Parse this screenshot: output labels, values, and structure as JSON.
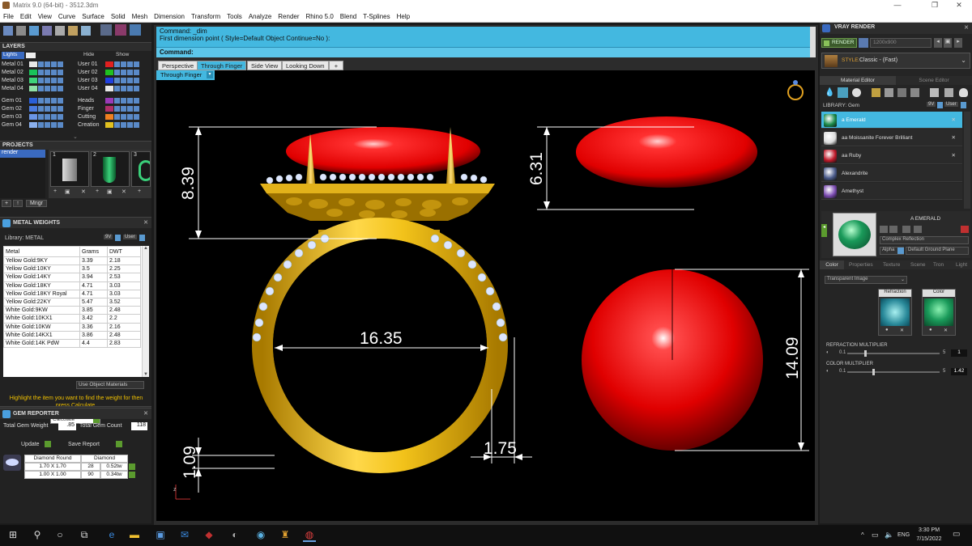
{
  "window": {
    "title": "Matrix 9.0 (64-bit) - 3512.3dm"
  },
  "menu": [
    "File",
    "Edit",
    "View",
    "Curve",
    "Surface",
    "Solid",
    "Mesh",
    "Dimension",
    "Transform",
    "Tools",
    "Analyze",
    "Render",
    "Rhino 5.0",
    "Blend",
    "T-Splines",
    "Help"
  ],
  "layers": {
    "title": "LAYERS",
    "toolbar": {
      "lights": "Lights",
      "hide": "Hide",
      "show": "Show"
    },
    "left": [
      {
        "name": "Metal 01",
        "color": "#e8e8e8"
      },
      {
        "name": "Metal 02",
        "color": "#19c35a"
      },
      {
        "name": "Metal 03",
        "color": "#3ed37a"
      },
      {
        "name": "Metal 04",
        "color": "#8fe0a6"
      },
      {
        "name": "Gem 01",
        "color": "#2a5fd8"
      },
      {
        "name": "Gem 02",
        "color": "#4a7be0"
      },
      {
        "name": "Gem 03",
        "color": "#6a95e6"
      },
      {
        "name": "Gem 04",
        "color": "#8ab0ee"
      }
    ],
    "right": [
      {
        "name": "User 01",
        "color": "#e02020"
      },
      {
        "name": "User 02",
        "color": "#20c020"
      },
      {
        "name": "User 03",
        "color": "#2040e0"
      },
      {
        "name": "User 04",
        "color": "#e8e8e8"
      },
      {
        "name": "Heads",
        "color": "#9b3ab8"
      },
      {
        "name": "Finger",
        "color": "#b0306a"
      },
      {
        "name": "Cutting",
        "color": "#f08020"
      },
      {
        "name": "Creation",
        "color": "#e0c020"
      }
    ]
  },
  "projects": {
    "title": "PROJECTS",
    "item": "render",
    "thumbs": [
      "1",
      "2",
      "3"
    ],
    "buttons": {
      "add": "+",
      "up": "↑",
      "manager": "Mngr"
    }
  },
  "metal_weights": {
    "title": "METAL WEIGHTS",
    "library_label": "Library: METAL",
    "columns": [
      "Metal",
      "Grams",
      "DWT"
    ],
    "rows": [
      [
        "Yellow Gold:9KY",
        "3.39",
        "2.18"
      ],
      [
        "Yellow Gold:10KY",
        "3.5",
        "2.25"
      ],
      [
        "Yellow Gold:14KY",
        "3.94",
        "2.53"
      ],
      [
        "Yellow Gold:18KY",
        "4.71",
        "3.03"
      ],
      [
        "Yellow Gold:18KY Royal",
        "4.71",
        "3.03"
      ],
      [
        "Yellow Gold:22KY",
        "5.47",
        "3.52"
      ],
      [
        "White Gold:9KW",
        "3.85",
        "2.48"
      ],
      [
        "White Gold:10KX1",
        "3.42",
        "2.2"
      ],
      [
        "White Gold:10KW",
        "3.36",
        "2.16"
      ],
      [
        "White Gold:14KX1",
        "3.86",
        "2.48"
      ],
      [
        "White Gold:14K PdW",
        "4.4",
        "2.83"
      ]
    ],
    "use_object_materials": "Use Object Materials",
    "hint": "Highlight the item you want to find the weight for then press Calculate.",
    "calculate": "Calculate"
  },
  "gem_reporter": {
    "title": "GEM REPORTER",
    "total_weight_label": "Total Gem Weight",
    "total_weight": ".85",
    "total_count_label": "Total Gem Count",
    "total_count": "118",
    "update": "Update",
    "save_report": "Save Report",
    "columns": [
      "Diamond Round",
      "Diamond"
    ],
    "rows": [
      [
        "1.70 X 1.70",
        "28",
        "0.52tw"
      ],
      [
        "1.00 X 1.00",
        "90",
        "0.34tw"
      ]
    ]
  },
  "command": {
    "line1": "Command: _dim",
    "line2": "First dimension point ( Style=Default  Object  Continue=No ):",
    "label": "Command:"
  },
  "view_tabs": [
    "Perspective",
    "Through Finger",
    "Side View",
    "Looking Down",
    "+"
  ],
  "viewport_label": "Through Finger",
  "dimensions": {
    "height": "8.39",
    "top_height": "6.31",
    "inner_diameter": "16.35",
    "sphere_height": "14.09",
    "band_width": "1.75",
    "band_thickness": "1.09"
  },
  "vray": {
    "title": "VRAY RENDER",
    "render_button": "RENDER",
    "resolution": "1200x900",
    "style_label": "STYLE:",
    "style_value": "Classic - (Fast)",
    "tabs": [
      "Material Editor",
      "Scene Editor"
    ],
    "library_label": "LIBRARY: Gem",
    "library_tags": [
      "9V",
      "User"
    ],
    "materials": [
      {
        "name": "a Emerald",
        "color": "#1a8a4a",
        "selected": true
      },
      {
        "name": "aa Moissanite Forever Brilliant",
        "color": "#dcdcdc",
        "selected": false
      },
      {
        "name": "aa Ruby",
        "color": "#c01a2a",
        "selected": false
      },
      {
        "name": "Alexandrite",
        "color": "#4a5a8a",
        "selected": false
      },
      {
        "name": "Amethyst",
        "color": "#7a4ab0",
        "selected": false
      }
    ],
    "preview_name": "A EMERALD",
    "preview_type": "Complex Reflection",
    "alpha_label": "Alpha",
    "ground_plane": "Default Ground Plane",
    "prop_tabs": [
      "Color",
      "Properties",
      "Texture",
      "Scene",
      "Tron",
      "Light"
    ],
    "transparent": "Transparent Image",
    "refraction_label": "Refraction",
    "color_label": "Color",
    "refraction_multiplier_label": "REFRACTION MULTIPLIER",
    "refraction_min": "0.1",
    "refraction_max": "5",
    "refraction_value": "1",
    "color_multiplier_label": "COLOR MULTIPLIER",
    "color_min": "0.1",
    "color_max": "5",
    "color_value": "1.42"
  },
  "taskbar": {
    "lang": "ENG",
    "time": "3:30 PM",
    "date": "7/15/2022"
  }
}
